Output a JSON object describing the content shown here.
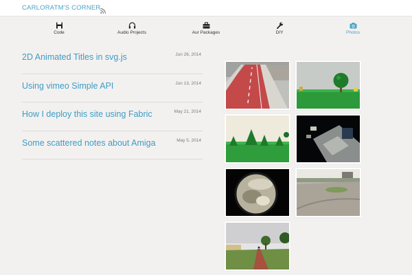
{
  "site": {
    "title": "CARLORATM'S CORNER"
  },
  "nav": [
    {
      "label": "Code",
      "icon": "floppy-disk-icon"
    },
    {
      "label": "Audio Projects",
      "icon": "headphones-icon"
    },
    {
      "label": "Aur Packages",
      "icon": "briefcase-icon"
    },
    {
      "label": "DIY",
      "icon": "wrench-icon"
    },
    {
      "label": "Photos",
      "icon": "camera-icon",
      "active": true
    }
  ],
  "posts": [
    {
      "title": "2D Animated Titles in svg.js",
      "date": "Jun 26, 2014"
    },
    {
      "title": "Using vimeo Simple API",
      "date": "Jun 13, 2014"
    },
    {
      "title": "How I deploy this site using Fabric",
      "date": "May 21, 2014"
    },
    {
      "title": "Some scattered notes about Amiga",
      "date": "May 5, 2014"
    }
  ],
  "photos": [
    {
      "subject": "bike-lane-street"
    },
    {
      "subject": "lego-tree"
    },
    {
      "subject": "lego-pine-trees"
    },
    {
      "subject": "dark-desk-laptop"
    },
    {
      "subject": "microscope-view"
    },
    {
      "subject": "dirt-field"
    },
    {
      "subject": "tree-lined-path"
    }
  ],
  "colors": {
    "accent": "#4aa3c8",
    "link": "#3d9cc6",
    "background": "#f3f1ef"
  }
}
